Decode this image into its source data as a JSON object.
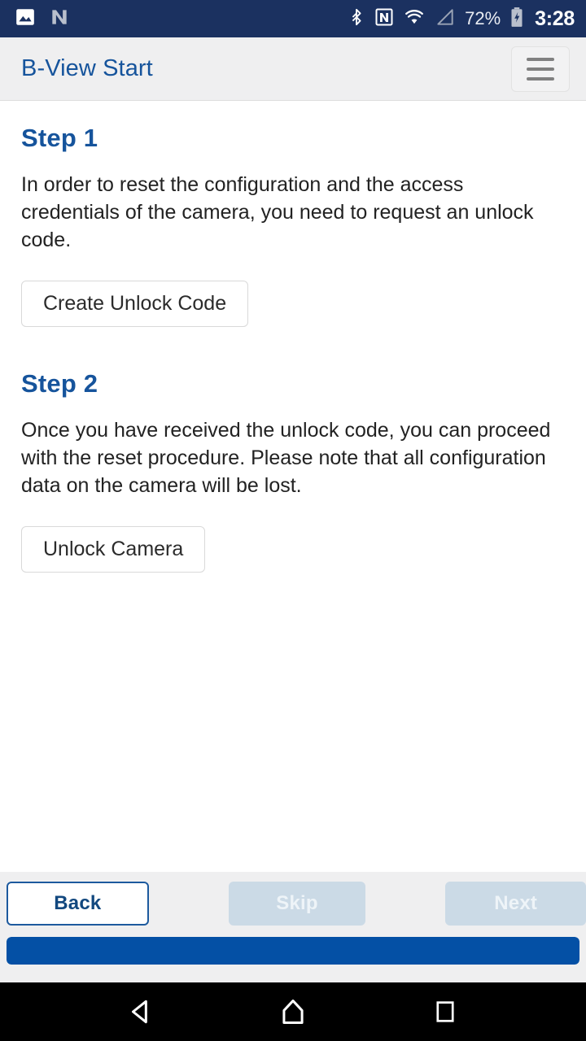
{
  "statusbar": {
    "icons_left": [
      "image-icon",
      "nfc-n-icon"
    ],
    "icons_right": [
      "bluetooth-icon",
      "nfc-icon",
      "wifi-icon",
      "signal-icon"
    ],
    "battery_percent": "72%",
    "battery_state": "charging",
    "clock": "3:28",
    "background_color": "#1b3160"
  },
  "appbar": {
    "title": "B-View Start",
    "title_color": "#16549c",
    "menu_icon": "hamburger-menu-icon",
    "background_color": "#efeff0"
  },
  "content": {
    "step1": {
      "heading": "Step 1",
      "body": "In order to reset the configuration and the access credentials of the camera, you need to request an unlock code.",
      "button_label": "Create Unlock Code"
    },
    "step2": {
      "heading": "Step 2",
      "body": "Once you have received the unlock code, you can proceed with the reset procedure. Please note that all configuration data on the camera will be lost.",
      "button_label": "Unlock Camera"
    },
    "heading_color": "#16549c"
  },
  "footer": {
    "back_label": "Back",
    "skip_label": "Skip",
    "next_label": "Next",
    "back_enabled": true,
    "skip_enabled": false,
    "next_enabled": false,
    "progress_percent": 100,
    "progress_color": "#0450a5",
    "background_color": "#efeff0"
  },
  "navbar": {
    "back_icon": "triangle-back-icon",
    "home_icon": "home-icon",
    "recents_icon": "square-recents-icon",
    "background_color": "#000000"
  }
}
